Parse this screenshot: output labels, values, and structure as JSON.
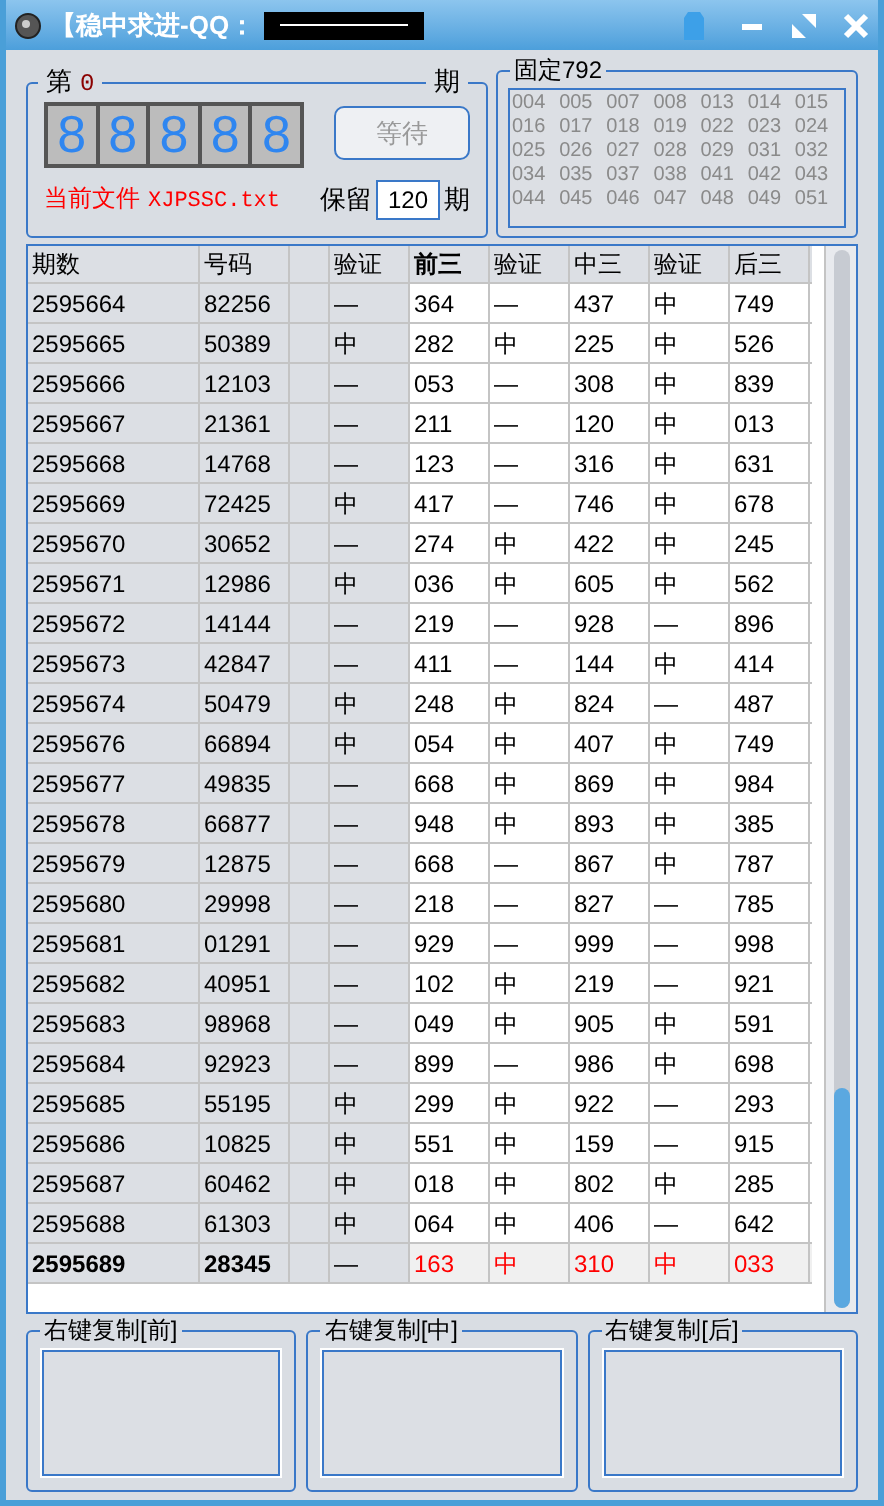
{
  "window": {
    "title": "【稳中求进-QQ："
  },
  "period": {
    "prefix": "第",
    "number": "0",
    "suffix": "期"
  },
  "digits": [
    "8",
    "8",
    "8",
    "8",
    "8"
  ],
  "wait_button": {
    "label": "等待",
    "disabled": true
  },
  "current_file": {
    "label": "当前文件",
    "value": "XJPSSC.txt"
  },
  "keep": {
    "label": "保留",
    "value": "120",
    "suffix": "期"
  },
  "fixed": {
    "title": "固定792",
    "numbers": [
      "004",
      "005",
      "007",
      "008",
      "013",
      "014",
      "015",
      "016",
      "017",
      "018",
      "019",
      "022",
      "023",
      "024",
      "025",
      "026",
      "027",
      "028",
      "029",
      "031",
      "032",
      "034",
      "035",
      "037",
      "038",
      "041",
      "042",
      "043",
      "044",
      "045",
      "046",
      "047",
      "048",
      "049",
      "051"
    ]
  },
  "table": {
    "columns": [
      "期数",
      "号码",
      "",
      "验证",
      "前三",
      "验证",
      "中三",
      "验证",
      "后三"
    ],
    "rows": [
      {
        "cells": [
          "2595664",
          "82256",
          "",
          "—",
          "364",
          "—",
          "437",
          "中",
          "749"
        ],
        "latest": false
      },
      {
        "cells": [
          "2595665",
          "50389",
          "",
          "中",
          "282",
          "中",
          "225",
          "中",
          "526"
        ],
        "latest": false
      },
      {
        "cells": [
          "2595666",
          "12103",
          "",
          "—",
          "053",
          "—",
          "308",
          "中",
          "839"
        ],
        "latest": false
      },
      {
        "cells": [
          "2595667",
          "21361",
          "",
          "—",
          "211",
          "—",
          "120",
          "中",
          "013"
        ],
        "latest": false
      },
      {
        "cells": [
          "2595668",
          "14768",
          "",
          "—",
          "123",
          "—",
          "316",
          "中",
          "631"
        ],
        "latest": false
      },
      {
        "cells": [
          "2595669",
          "72425",
          "",
          "中",
          "417",
          "—",
          "746",
          "中",
          "678"
        ],
        "latest": false
      },
      {
        "cells": [
          "2595670",
          "30652",
          "",
          "—",
          "274",
          "中",
          "422",
          "中",
          "245"
        ],
        "latest": false
      },
      {
        "cells": [
          "2595671",
          "12986",
          "",
          "中",
          "036",
          "中",
          "605",
          "中",
          "562"
        ],
        "latest": false
      },
      {
        "cells": [
          "2595672",
          "14144",
          "",
          "—",
          "219",
          "—",
          "928",
          "—",
          "896"
        ],
        "latest": false
      },
      {
        "cells": [
          "2595673",
          "42847",
          "",
          "—",
          "411",
          "—",
          "144",
          "中",
          "414"
        ],
        "latest": false
      },
      {
        "cells": [
          "2595674",
          "50479",
          "",
          "中",
          "248",
          "中",
          "824",
          "—",
          "487"
        ],
        "latest": false
      },
      {
        "cells": [
          "2595676",
          "66894",
          "",
          "中",
          "054",
          "中",
          "407",
          "中",
          "749"
        ],
        "latest": false
      },
      {
        "cells": [
          "2595677",
          "49835",
          "",
          "—",
          "668",
          "中",
          "869",
          "中",
          "984"
        ],
        "latest": false
      },
      {
        "cells": [
          "2595678",
          "66877",
          "",
          "—",
          "948",
          "中",
          "893",
          "中",
          "385"
        ],
        "latest": false
      },
      {
        "cells": [
          "2595679",
          "12875",
          "",
          "—",
          "668",
          "—",
          "867",
          "中",
          "787"
        ],
        "latest": false
      },
      {
        "cells": [
          "2595680",
          "29998",
          "",
          "—",
          "218",
          "—",
          "827",
          "—",
          "785"
        ],
        "latest": false
      },
      {
        "cells": [
          "2595681",
          "01291",
          "",
          "—",
          "929",
          "—",
          "999",
          "—",
          "998"
        ],
        "latest": false
      },
      {
        "cells": [
          "2595682",
          "40951",
          "",
          "—",
          "102",
          "中",
          "219",
          "—",
          "921"
        ],
        "latest": false
      },
      {
        "cells": [
          "2595683",
          "98968",
          "",
          "—",
          "049",
          "中",
          "905",
          "中",
          "591"
        ],
        "latest": false
      },
      {
        "cells": [
          "2595684",
          "92923",
          "",
          "—",
          "899",
          "—",
          "986",
          "中",
          "698"
        ],
        "latest": false
      },
      {
        "cells": [
          "2595685",
          "55195",
          "",
          "中",
          "299",
          "中",
          "922",
          "—",
          "293"
        ],
        "latest": false
      },
      {
        "cells": [
          "2595686",
          "10825",
          "",
          "中",
          "551",
          "中",
          "159",
          "—",
          "915"
        ],
        "latest": false
      },
      {
        "cells": [
          "2595687",
          "60462",
          "",
          "中",
          "018",
          "中",
          "802",
          "中",
          "285"
        ],
        "latest": false
      },
      {
        "cells": [
          "2595688",
          "61303",
          "",
          "中",
          "064",
          "中",
          "406",
          "—",
          "642"
        ],
        "latest": false
      },
      {
        "cells": [
          "2595689",
          "28345",
          "",
          "—",
          "163",
          "中",
          "310",
          "中",
          "033"
        ],
        "latest": true
      }
    ]
  },
  "copy_boxes": [
    {
      "title": "右键复制[前]"
    },
    {
      "title": "右键复制[中]"
    },
    {
      "title": "右键复制[后]"
    }
  ]
}
